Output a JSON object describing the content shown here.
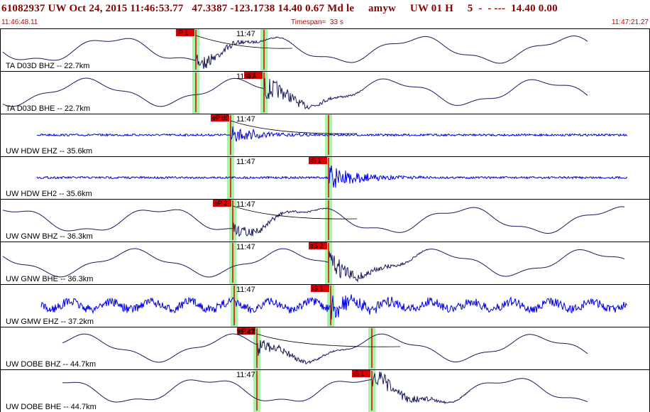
{
  "header": {
    "title": "61082937 UW Oct 24, 2015 11:46:53.77   47.3387 -123.1738 14.40 0.67 Md le     amyw     UW 01 H     5  -  - ---  14.40 0.00",
    "start_time": "11:46:48.11",
    "timespan": "Timespan=  33 s",
    "end_time": "11:47:21.27"
  },
  "minute_label": "11:47",
  "colors": {
    "trace_dark": "#1a1a5e",
    "trace_blue": "#0000e6",
    "pick": "#e00000",
    "highlight": "#a6f5a6",
    "title": "#8b0000"
  },
  "panels": [
    {
      "station": "TA D03D BHZ -- 22.7km",
      "pick": "iP 1",
      "color": "dark",
      "style": "wave",
      "pA": 276,
      "pB": 372,
      "big": 0
    },
    {
      "station": "TA D03D BHE -- 22.7km",
      "pick": "iS 1",
      "color": "dark",
      "style": "wave",
      "pA": 276,
      "pB": 372,
      "big": 1
    },
    {
      "station": "UW HDW EHZ -- 35.6km",
      "pick": "eP d0",
      "color": "blue",
      "style": "flat",
      "pA": 325,
      "pB": 463,
      "big": 0
    },
    {
      "station": "UW HDW EH2 -- 35.6km",
      "pick": "iS 1",
      "color": "blue",
      "style": "flat",
      "pA": 325,
      "pB": 463,
      "big": 1
    },
    {
      "station": "UW GNW BHZ -- 36.3km",
      "pick": "eP 2",
      "color": "dark",
      "style": "wave",
      "pA": 328,
      "pB": 463,
      "big": 0
    },
    {
      "station": "UW GNW BHE -- 36.3km",
      "pick": "eS 2",
      "color": "dark",
      "style": "wave",
      "pA": 328,
      "pB": 463,
      "big": 1
    },
    {
      "station": "UW GMW EHZ -- 37.2km",
      "pick": "iS 1",
      "color": "blue",
      "style": "noise",
      "pA": 330,
      "pB": 466,
      "big": 1
    },
    {
      "station": "UW DOBE BHZ -- 44.7km",
      "pick": "eP c1",
      "color": "dark",
      "style": "wave",
      "pA": 362,
      "pB": 524,
      "big": 0
    },
    {
      "station": "UW DOBE BHE -- 44.7km",
      "pick": "iS 1",
      "color": "dark",
      "style": "wave",
      "pA": 362,
      "pB": 524,
      "big": 1
    }
  ]
}
